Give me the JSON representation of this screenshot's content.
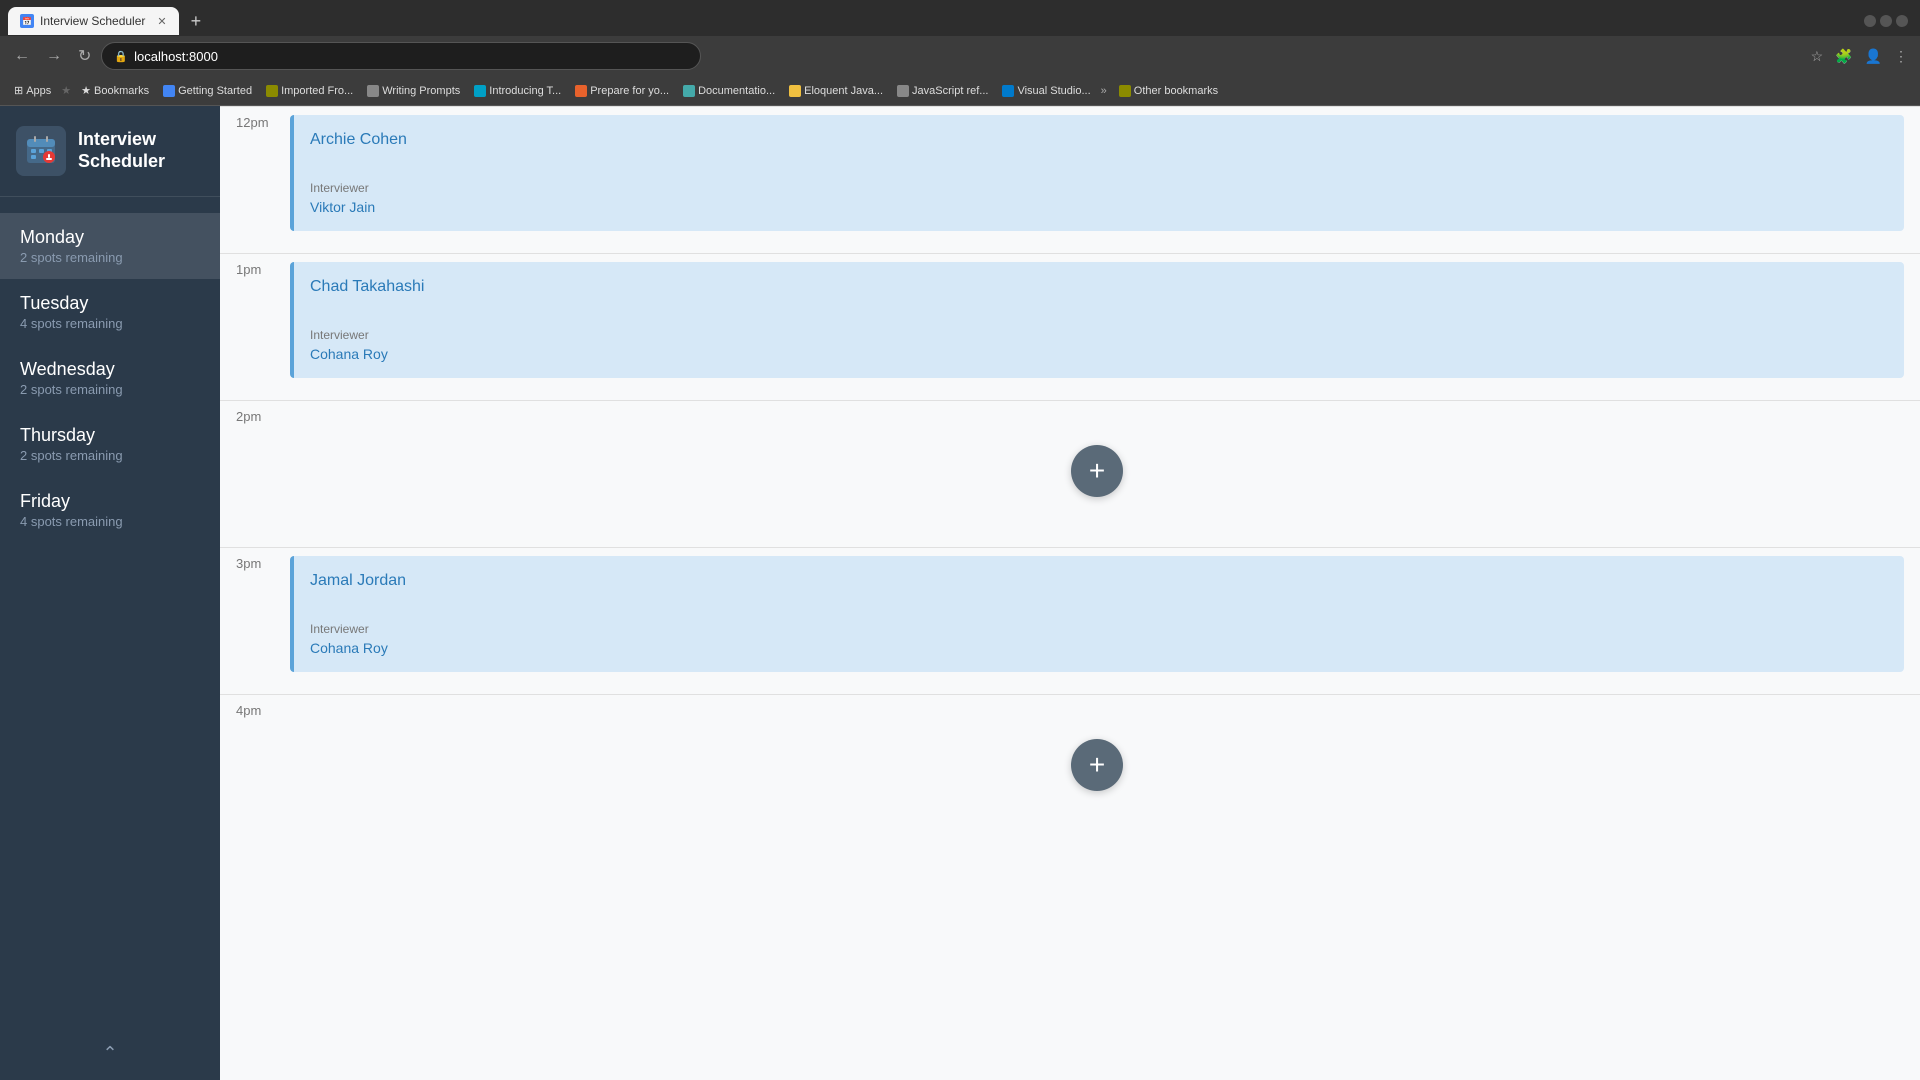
{
  "browser": {
    "tab_title": "Interview Scheduler",
    "address": "localhost:8000",
    "bookmarks": [
      {
        "label": "Apps",
        "icon": "grid"
      },
      {
        "label": "Bookmarks",
        "icon": "star"
      },
      {
        "label": "Getting Started",
        "icon": "page"
      },
      {
        "label": "Imported Fro...",
        "icon": "folder"
      },
      {
        "label": "Writing Prompts",
        "icon": "page"
      },
      {
        "label": "Introducing T...",
        "icon": "page"
      },
      {
        "label": "Prepare for yo...",
        "icon": "page"
      },
      {
        "label": "Documentatio...",
        "icon": "page"
      },
      {
        "label": "Eloquent Java...",
        "icon": "page"
      },
      {
        "label": "JavaScript ref...",
        "icon": "page"
      },
      {
        "label": "Visual Studio...",
        "icon": "page"
      },
      {
        "label": "Other bookmarks",
        "icon": "folder"
      }
    ]
  },
  "app": {
    "title_line1": "Interview",
    "title_line2": "Scheduler",
    "nav_items": [
      {
        "day": "Monday",
        "spots": "2 spots remaining",
        "active": true
      },
      {
        "day": "Tuesday",
        "spots": "4 spots remaining",
        "active": false
      },
      {
        "day": "Wednesday",
        "spots": "2 spots remaining",
        "active": false
      },
      {
        "day": "Thursday",
        "spots": "2 spots remaining",
        "active": false
      },
      {
        "day": "Friday",
        "spots": "4 spots remaining",
        "active": false
      }
    ]
  },
  "schedule": {
    "time_slots": [
      {
        "label": "12pm",
        "type": "card",
        "candidate": "Archie Cohen",
        "interviewer_label": "Interviewer",
        "interviewer": "Viktor Jain"
      },
      {
        "label": "1pm",
        "type": "card",
        "candidate": "Chad Takahashi",
        "interviewer_label": "Interviewer",
        "interviewer": "Cohana Roy"
      },
      {
        "label": "2pm",
        "type": "add"
      },
      {
        "label": "3pm",
        "type": "card",
        "candidate": "Jamal Jordan",
        "interviewer_label": "Interviewer",
        "interviewer": "Cohana Roy"
      },
      {
        "label": "4pm",
        "type": "add"
      }
    ],
    "add_button_label": "+"
  }
}
